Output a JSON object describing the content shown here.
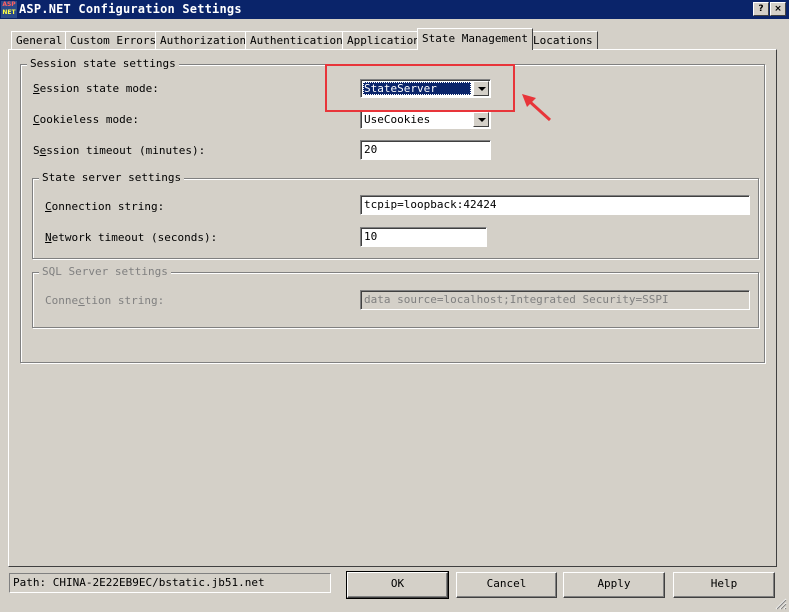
{
  "window": {
    "title": "ASP.NET Configuration Settings",
    "icon_text_top": "ASP",
    "icon_text_bottom": "NET",
    "help_button": "?",
    "close_button": "×"
  },
  "tabs": [
    {
      "label": "General"
    },
    {
      "label": "Custom Errors"
    },
    {
      "label": "Authorization"
    },
    {
      "label": "Authentication"
    },
    {
      "label": "Application"
    },
    {
      "label": "State Management",
      "active": true
    },
    {
      "label": "Locations"
    }
  ],
  "session": {
    "group_label": "Session state settings",
    "mode_label_key": "S",
    "mode_label_rest": "ession state mode:",
    "mode_value": "StateServer",
    "cookieless_label_key": "C",
    "cookieless_label_rest": "ookieless mode:",
    "cookieless_value": "UseCookies",
    "timeout_label_pre": "S",
    "timeout_label_key": "e",
    "timeout_label_rest": "ssion timeout (minutes):",
    "timeout_value": "20"
  },
  "state_server": {
    "group_label": "State server settings",
    "conn_label_key": "C",
    "conn_label_rest": "onnection string:",
    "conn_value": "tcpip=loopback:42424",
    "timeout_label_key": "N",
    "timeout_label_rest": "etwork timeout (seconds):",
    "timeout_value": "10"
  },
  "sql_server": {
    "group_label": "SQL Server settings",
    "conn_label_pre": "Conne",
    "conn_label_key": "c",
    "conn_label_rest": "tion string:",
    "conn_value": "data source=localhost;Integrated Security=SSPI"
  },
  "footer": {
    "path": "Path: CHINA-2E22EB9EC/bstatic.jb51.net",
    "ok": "OK",
    "cancel": "Cancel",
    "apply": "Apply",
    "help": "Help"
  },
  "colors": {
    "titlebar": "#0a246a",
    "annotation": "#e8353a",
    "face": "#d4d0c8"
  }
}
